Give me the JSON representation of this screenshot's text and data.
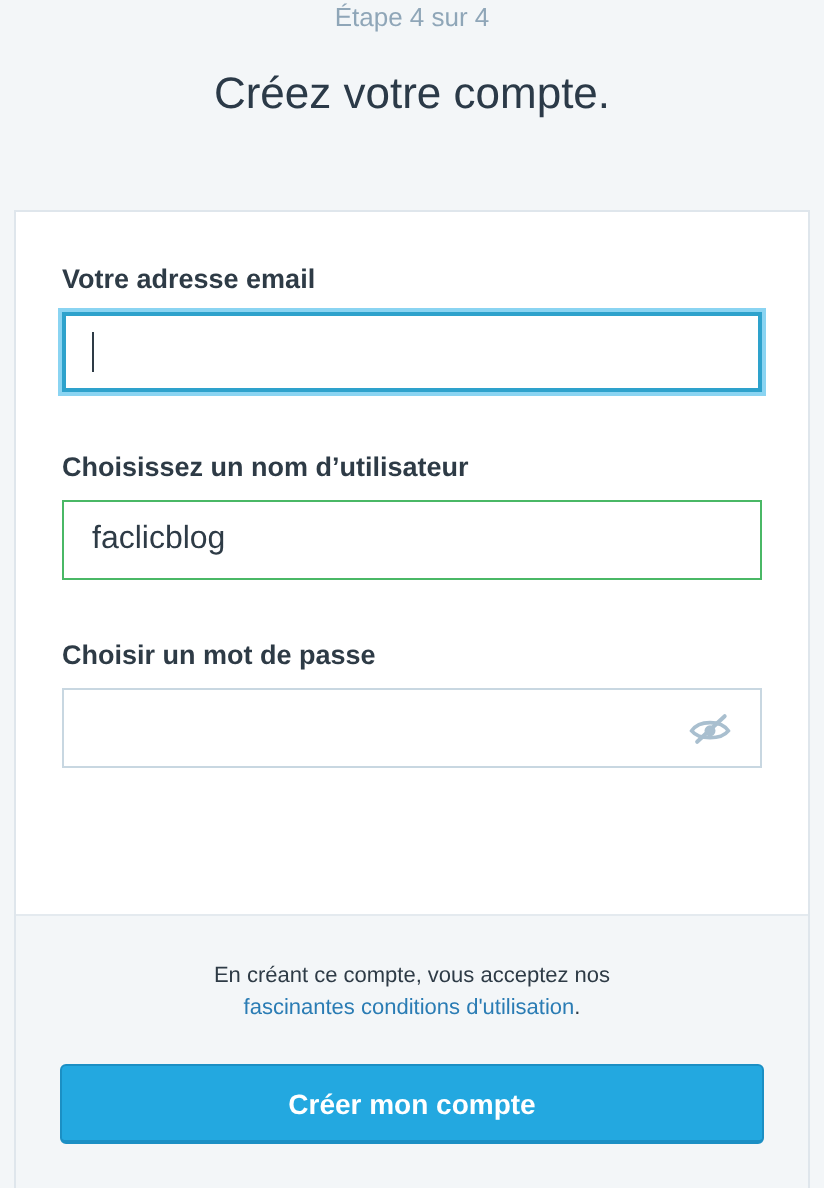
{
  "step": "Étape 4 sur 4",
  "title": "Créez votre compte.",
  "fields": [
    {
      "label": "Votre adresse email",
      "kind": "text",
      "focused": true,
      "valid": false
    },
    {
      "label": "Choisissez un nom d’utilisateur",
      "kind": "text",
      "focused": false,
      "valid": true,
      "value": "faclicblog"
    },
    {
      "label": "Choisir un mot de passe",
      "kind": "password",
      "focused": false,
      "valid": false
    }
  ],
  "terms": {
    "text": "En créant ce compte, vous acceptez nos",
    "link": "fascinantes conditions d'utilisation",
    "suffix": "."
  },
  "submit": "Créer mon compte"
}
